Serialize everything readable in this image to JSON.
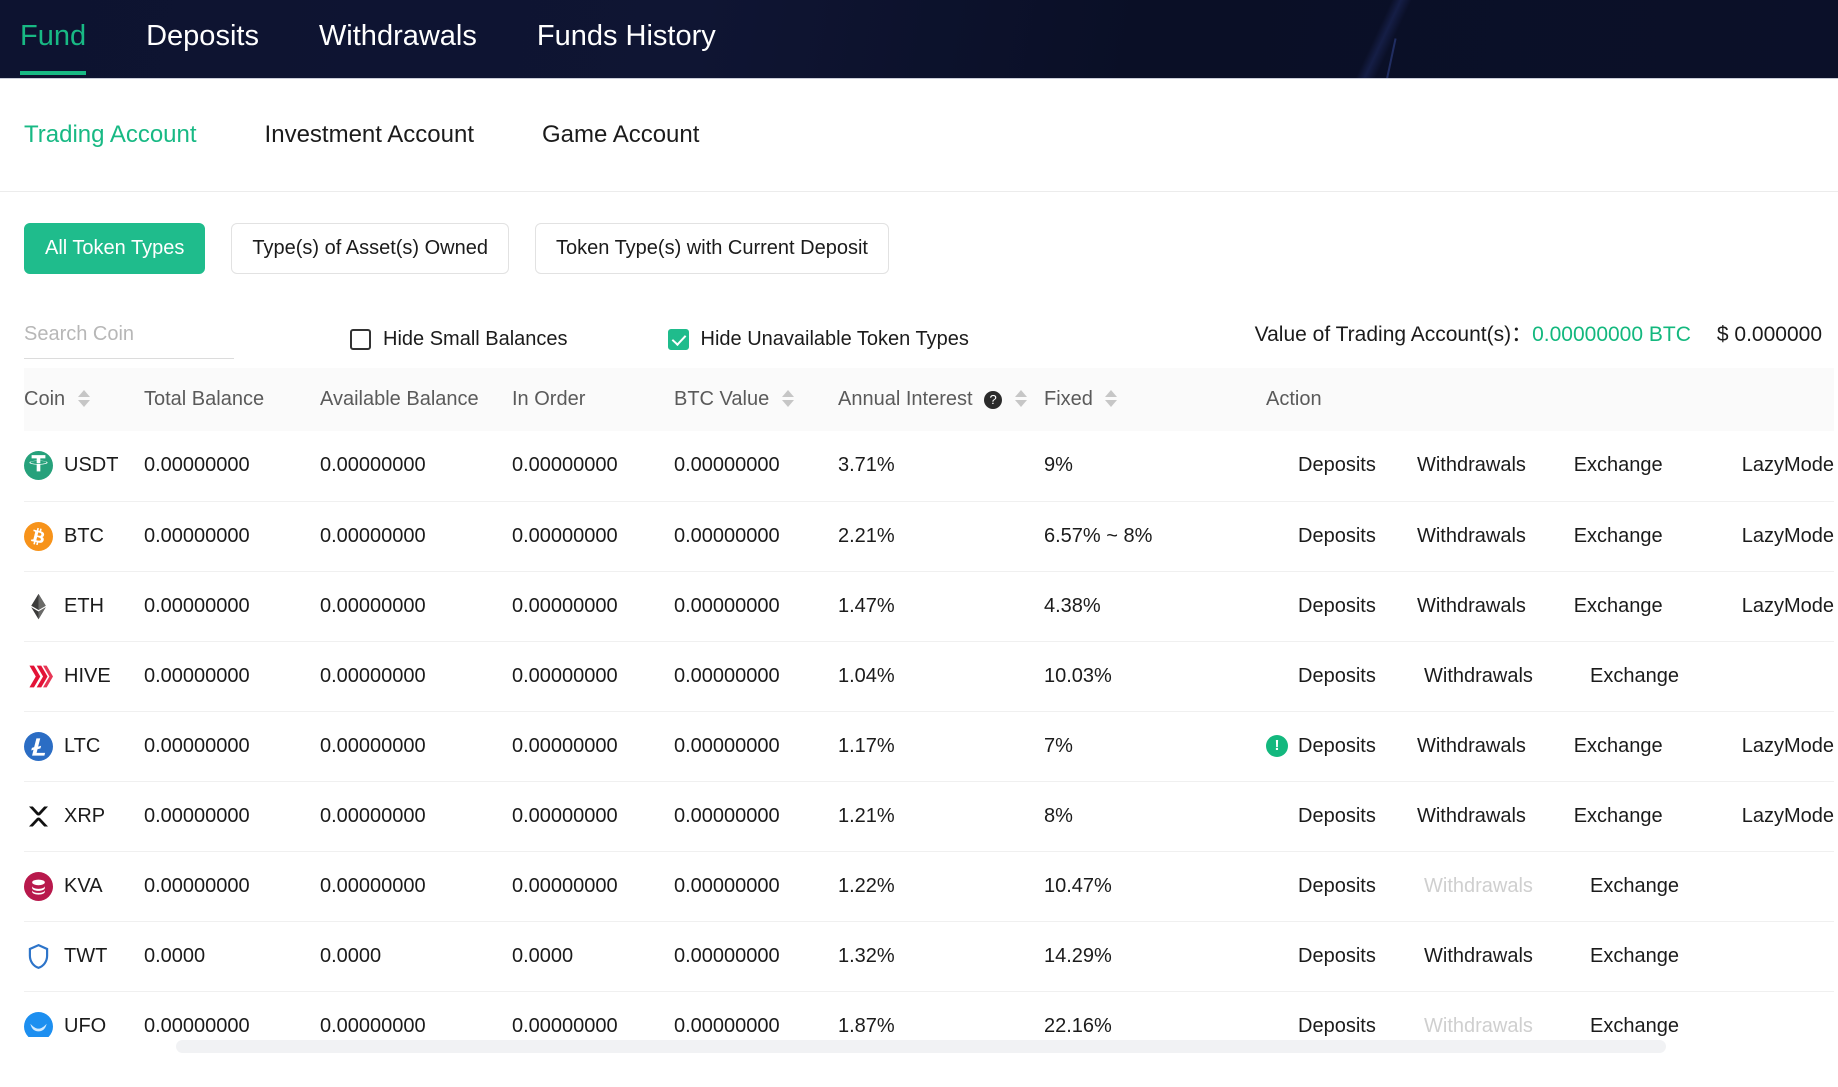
{
  "topnav": {
    "items": [
      {
        "label": "Fund",
        "active": true
      },
      {
        "label": "Deposits",
        "active": false
      },
      {
        "label": "Withdrawals",
        "active": false
      },
      {
        "label": "Funds History",
        "active": false
      }
    ]
  },
  "account_tabs": [
    {
      "label": "Trading Account",
      "active": true
    },
    {
      "label": "Investment Account",
      "active": false
    },
    {
      "label": "Game Account",
      "active": false
    }
  ],
  "token_filters": [
    {
      "label": "All Token Types",
      "active": true
    },
    {
      "label": "Type(s) of Asset(s) Owned",
      "active": false
    },
    {
      "label": "Token Type(s) with Current Deposit",
      "active": false
    }
  ],
  "search": {
    "placeholder": "Search Coin",
    "value": ""
  },
  "checkboxes": [
    {
      "label": "Hide Small Balances",
      "checked": false
    },
    {
      "label": "Hide Unavailable Token Types",
      "checked": true
    }
  ],
  "account_value": {
    "label": "Value of Trading Account(s)：",
    "btc": "0.00000000 BTC",
    "usd": "$ 0.000000",
    "btc_color": "#13b87e"
  },
  "table": {
    "headers": {
      "coin": "Coin",
      "total_balance": "Total Balance",
      "available_balance": "Available Balance",
      "in_order": "In Order",
      "btc_value": "BTC Value",
      "annual_interest": "Annual Interest",
      "annual_interest_help": "?",
      "fixed": "Fixed",
      "action": "Action"
    },
    "action_labels": {
      "deposits": "Deposits",
      "withdrawals": "Withdrawals",
      "exchange": "Exchange",
      "lazymode": "LazyMode"
    },
    "rows": [
      {
        "coin": "USDT",
        "icon": "usdt-icon",
        "total_balance": "0.00000000",
        "available_balance": "0.00000000",
        "in_order": "0.00000000",
        "btc_value": "0.00000000",
        "annual_interest": "3.71%",
        "fixed": "9%",
        "warn": false,
        "withdrawals_disabled": false,
        "lazymode": true
      },
      {
        "coin": "BTC",
        "icon": "btc-icon",
        "total_balance": "0.00000000",
        "available_balance": "0.00000000",
        "in_order": "0.00000000",
        "btc_value": "0.00000000",
        "annual_interest": "2.21%",
        "fixed": "6.57% ~ 8%",
        "warn": false,
        "withdrawals_disabled": false,
        "lazymode": true
      },
      {
        "coin": "ETH",
        "icon": "eth-icon",
        "total_balance": "0.00000000",
        "available_balance": "0.00000000",
        "in_order": "0.00000000",
        "btc_value": "0.00000000",
        "annual_interest": "1.47%",
        "fixed": "4.38%",
        "warn": false,
        "withdrawals_disabled": false,
        "lazymode": true
      },
      {
        "coin": "HIVE",
        "icon": "hive-icon",
        "total_balance": "0.00000000",
        "available_balance": "0.00000000",
        "in_order": "0.00000000",
        "btc_value": "0.00000000",
        "annual_interest": "1.04%",
        "fixed": "10.03%",
        "warn": false,
        "withdrawals_disabled": false,
        "lazymode": false
      },
      {
        "coin": "LTC",
        "icon": "ltc-icon",
        "total_balance": "0.00000000",
        "available_balance": "0.00000000",
        "in_order": "0.00000000",
        "btc_value": "0.00000000",
        "annual_interest": "1.17%",
        "fixed": "7%",
        "warn": true,
        "withdrawals_disabled": false,
        "lazymode": true
      },
      {
        "coin": "XRP",
        "icon": "xrp-icon",
        "total_balance": "0.00000000",
        "available_balance": "0.00000000",
        "in_order": "0.00000000",
        "btc_value": "0.00000000",
        "annual_interest": "1.21%",
        "fixed": "8%",
        "warn": false,
        "withdrawals_disabled": false,
        "lazymode": true
      },
      {
        "coin": "KVA",
        "icon": "kva-icon",
        "total_balance": "0.00000000",
        "available_balance": "0.00000000",
        "in_order": "0.00000000",
        "btc_value": "0.00000000",
        "annual_interest": "1.22%",
        "fixed": "10.47%",
        "warn": false,
        "withdrawals_disabled": true,
        "lazymode": false
      },
      {
        "coin": "TWT",
        "icon": "twt-icon",
        "total_balance": "0.0000",
        "available_balance": "0.0000",
        "in_order": "0.0000",
        "btc_value": "0.00000000",
        "annual_interest": "1.32%",
        "fixed": "14.29%",
        "warn": false,
        "withdrawals_disabled": false,
        "lazymode": false
      },
      {
        "coin": "UFO",
        "icon": "ufo-icon",
        "total_balance": "0.00000000",
        "available_balance": "0.00000000",
        "in_order": "0.00000000",
        "btc_value": "0.00000000",
        "annual_interest": "1.87%",
        "fixed": "22.16%",
        "warn": false,
        "withdrawals_disabled": true,
        "lazymode": false
      }
    ]
  },
  "colors": {
    "accent_green": "#1fbc8c",
    "nav_dark": "#0d1330",
    "link_green": "#18b984"
  }
}
